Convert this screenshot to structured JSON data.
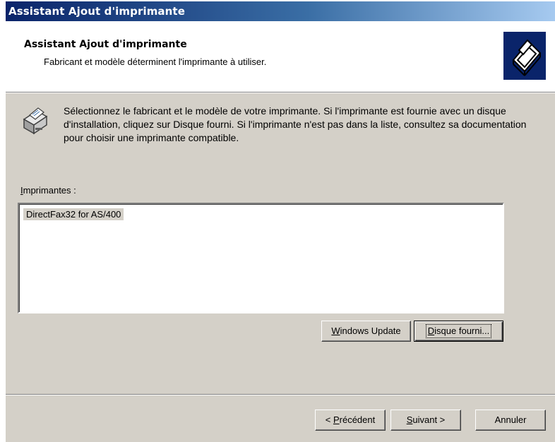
{
  "window": {
    "title": "Assistant Ajout d'imprimante"
  },
  "header": {
    "title": "Assistant Ajout d'imprimante",
    "subtitle": "Fabricant et modèle déterminent l'imprimante à utiliser.",
    "icon": "printer-wizard-icon"
  },
  "instructions": {
    "icon": "printer-icon",
    "text": "Sélectionnez le fabricant et le modèle de votre imprimante. Si l'imprimante est fournie avec un disque d'installation, cliquez sur Disque fourni. Si l'imprimante n'est pas dans la liste, consultez sa documentation pour choisir une imprimante compatible."
  },
  "printers": {
    "label_access_key": "I",
    "label_rest": "mprimantes :",
    "items": [
      "DirectFax32 for AS/400"
    ],
    "selected_index": 0
  },
  "buttons": {
    "windows_update": {
      "access_key": "W",
      "rest": "indows Update"
    },
    "have_disk": {
      "access_key": "D",
      "rest": "isque fourni..."
    },
    "back": {
      "prefix": "< ",
      "access_key": "P",
      "rest": "récédent"
    },
    "next": {
      "access_key": "S",
      "rest": "uivant >"
    },
    "cancel": {
      "label": "Annuler"
    }
  },
  "colors": {
    "titlebar_start": "#0a246a",
    "titlebar_end": "#a6caf0",
    "face": "#d4d0c8",
    "selection": "#d4d0c8"
  }
}
